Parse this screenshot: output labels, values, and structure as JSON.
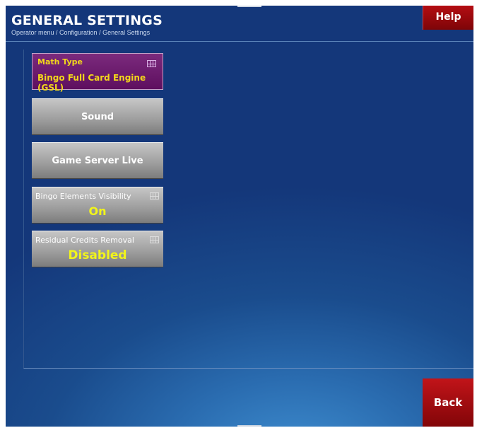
{
  "header": {
    "title": "GENERAL SETTINGS",
    "breadcrumb": "Operator menu / Configuration / General Settings"
  },
  "buttons": {
    "help_label": "Help",
    "back_label": "Back"
  },
  "math_type": {
    "title": "Math Type",
    "value": "Bingo Full Card Engine (GSL)"
  },
  "menu": {
    "sound_label": "Sound",
    "game_server_label": "Game Server Live",
    "bingo_visibility": {
      "title": "Bingo Elements Visibility",
      "value": "On"
    },
    "residual_credits": {
      "title": "Residual Credits Removal",
      "value": "Disabled"
    }
  },
  "colors": {
    "accent_red": "#b40d12",
    "value_yellow": "#f2f51a",
    "math_purple": "#7b2a7d",
    "background_blue": "#1a4c8d"
  },
  "icons": {
    "tile_icon": "grid-icon"
  }
}
